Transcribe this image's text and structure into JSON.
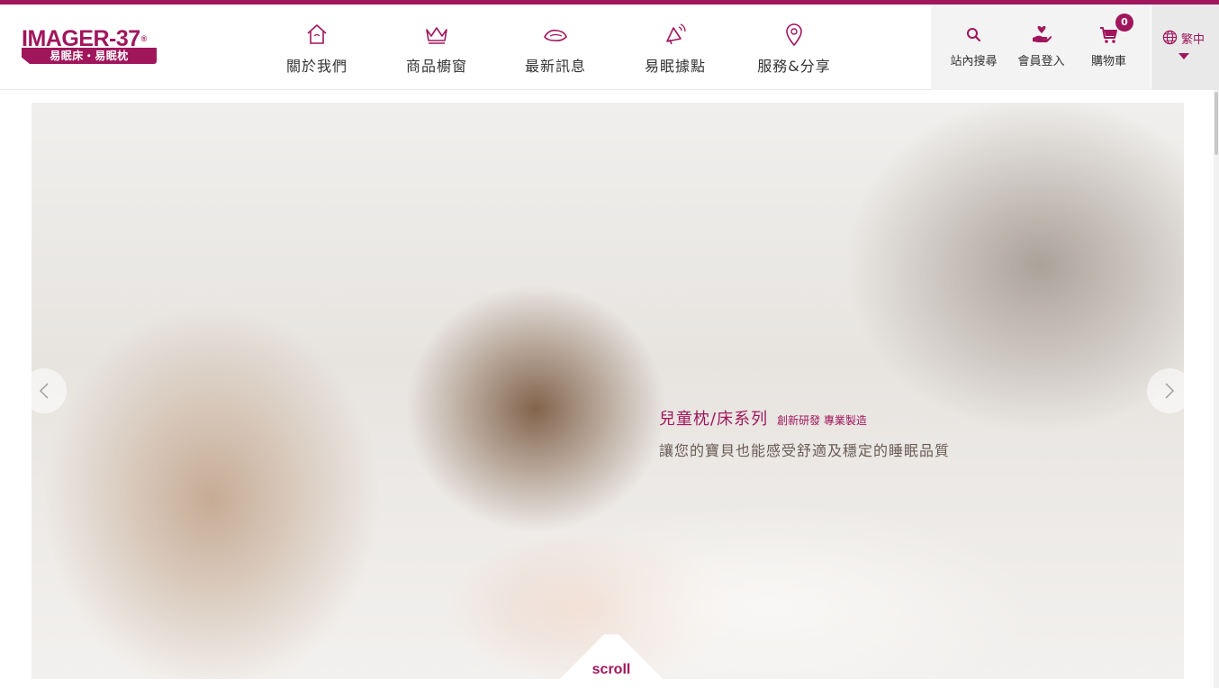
{
  "colors": {
    "brand": "#a0165c",
    "util_bg": "#f3f3f3",
    "lang_bg": "#e9e9e9"
  },
  "logo": {
    "main": "IMAGER-37",
    "sub": "易眠床・易眠枕"
  },
  "nav": [
    {
      "label": "關於我們",
      "icon": "house-icon"
    },
    {
      "label": "商品櫥窗",
      "icon": "crown-icon"
    },
    {
      "label": "最新訊息",
      "icon": "pillow-icon"
    },
    {
      "label": "易眠據點",
      "icon": "megaphone-icon"
    },
    {
      "label": "服務&分享",
      "icon": "map-pin-icon"
    }
  ],
  "utilities": {
    "search": {
      "label": "站內搜尋",
      "icon": "search-icon"
    },
    "member": {
      "label": "會員登入",
      "icon": "hand-heart-icon"
    },
    "cart": {
      "label": "購物車",
      "icon": "cart-icon",
      "count": "0"
    }
  },
  "language": {
    "label": "繁中",
    "icon": "globe-icon"
  },
  "hero": {
    "title": "兒童枕/床系列",
    "tagline": "創新研發 專業製造",
    "description": "讓您的寶貝也能感受舒適及穩定的睡眠品質"
  },
  "scroll": {
    "label": "scroll"
  }
}
